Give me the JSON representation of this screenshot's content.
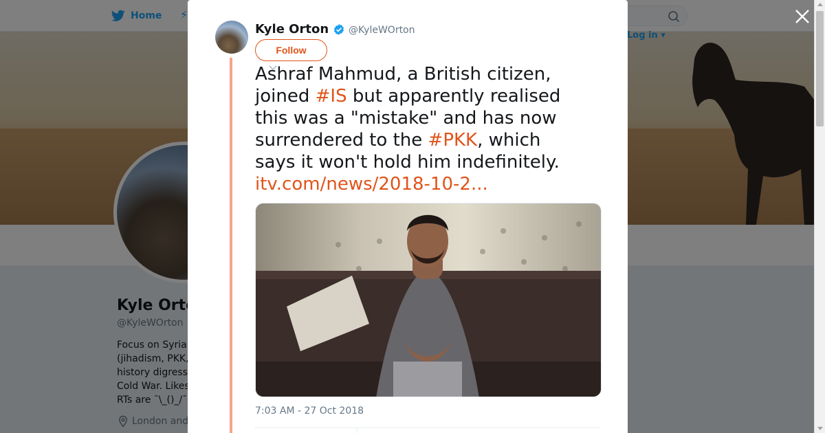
{
  "colors": {
    "brand_blue": "#1da1f2",
    "accent_orange": "#e0541a",
    "thread_line": "#f4a48a",
    "text_primary": "#14171a",
    "text_secondary": "#657786"
  },
  "topbar": {
    "home_label": "Home",
    "login_label": "Log in"
  },
  "profile": {
    "name": "Kyle Ortc",
    "handle": "@KyleWOrton",
    "bio_lines": [
      "Focus on Syria",
      "(jihadism, PKK,",
      "history digress",
      "Cold War. Likes",
      "RTs are ¯\\_()_/¯"
    ],
    "location": "London and"
  },
  "tweet": {
    "author_name": "Kyle Orton",
    "author_handle": "@KyleWOrton",
    "follow_label": "Follow",
    "text": {
      "line1": "Ashraf Mahmud, a British citizen,",
      "line2_pre": "joined ",
      "line2_tag": "#IS",
      "line2_post": " but apparently realised",
      "line3": "this was a \"mistake\" and has now",
      "line4_pre": "surrendered to the ",
      "line4_tag": "#PKK",
      "line4_post": ", which",
      "line5": "says it won't hold him indefinitely.",
      "link": "itv.com/news/2018-10-2..."
    },
    "timestamp": "7:03 AM - 27 Oct 2018"
  },
  "icons": {
    "topbar": [
      "twitter-bird-icon",
      "moments-icon",
      "search-icon"
    ],
    "modal": [
      "close-icon",
      "verified-badge-icon",
      "chevron-down-icon"
    ],
    "profile": [
      "location-pin-icon"
    ]
  }
}
